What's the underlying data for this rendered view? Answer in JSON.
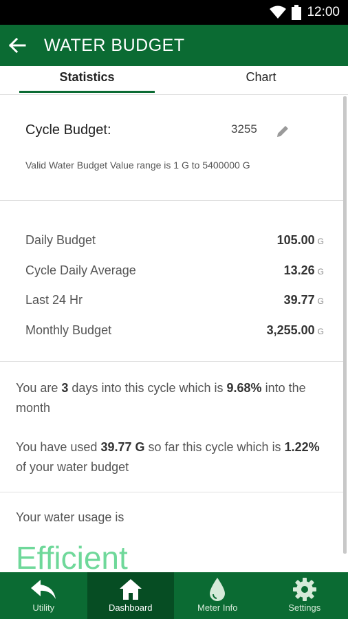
{
  "status_bar": {
    "time": "12:00"
  },
  "app_bar": {
    "title": "WATER BUDGET"
  },
  "tabs": [
    {
      "label": "Statistics",
      "active": true
    },
    {
      "label": "Chart",
      "active": false
    }
  ],
  "budget": {
    "label": "Cycle Budget:",
    "value": "3255",
    "range_note": "Valid Water Budget Value range is 1 G to 5400000 G"
  },
  "stats": [
    {
      "label": "Daily Budget",
      "value": "105.00",
      "unit": "G"
    },
    {
      "label": "Cycle Daily Average",
      "value": "13.26",
      "unit": "G"
    },
    {
      "label": "Last 24 Hr",
      "value": "39.77",
      "unit": "G"
    },
    {
      "label": "Monthly Budget",
      "value": "3,255.00",
      "unit": "G"
    }
  ],
  "cycle_info": {
    "p1_a": "You are ",
    "p1_days": "3",
    "p1_b": " days into this cycle which is ",
    "p1_pct": "9.68%",
    "p1_c": " into the month",
    "p2_a": "You have used ",
    "p2_used": "39.77 G",
    "p2_b": " so far this cycle which is ",
    "p2_pct": "1.22%",
    "p2_c": " of your water budget"
  },
  "usage": {
    "label": "Your water usage is",
    "status": "Efficient",
    "status_color": "#6fd89a"
  },
  "bottom_nav": [
    {
      "label": "Utility",
      "icon": "reply-arrow-icon",
      "active": false
    },
    {
      "label": "Dashboard",
      "icon": "home-icon",
      "active": true
    },
    {
      "label": "Meter Info",
      "icon": "water-drop-icon",
      "active": false
    },
    {
      "label": "Settings",
      "icon": "gear-icon",
      "active": false
    }
  ],
  "colors": {
    "primary": "#0b6b33",
    "primary_dark": "#064d23",
    "accent": "#6fd89a"
  }
}
